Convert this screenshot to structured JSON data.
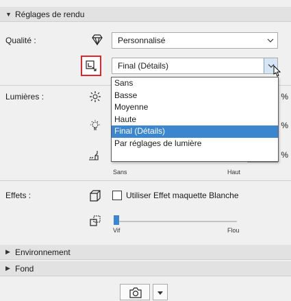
{
  "header": {
    "title": "Réglages de rendu"
  },
  "quality": {
    "label": "Qualité :",
    "preset_value": "Personnalisé",
    "detail_value": "Final (Détails)"
  },
  "dropdown": {
    "options": [
      "Sans",
      "Basse",
      "Moyenne",
      "Haute",
      "Final (Détails)",
      "Par réglages de lumière"
    ],
    "selected_index": 4
  },
  "lights": {
    "label": "Lumières :",
    "percent_symbol": "%",
    "scale_min": "Sans",
    "scale_max": "Haut"
  },
  "effects": {
    "label": "Effets :",
    "checkbox_label": "Utiliser Effet maquette Blanche",
    "slider_min": "Vif",
    "slider_max": "Flou"
  },
  "collapsed_sections": [
    "Environnement",
    "Fond"
  ],
  "colors": {
    "accent": "#3c86cf",
    "highlight_border": "#e0262a"
  }
}
